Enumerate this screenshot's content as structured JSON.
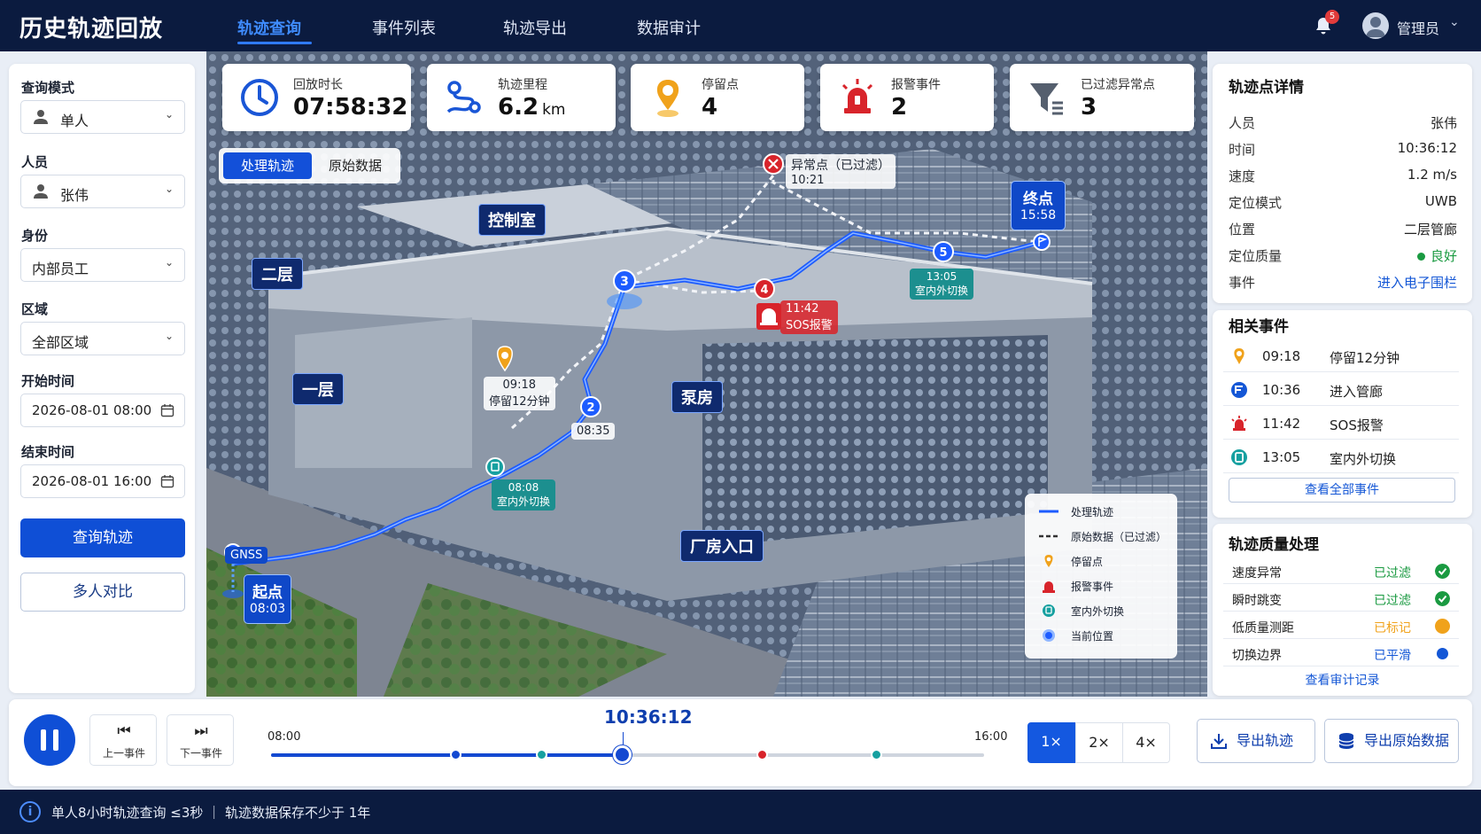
{
  "header": {
    "title": "历史轨迹回放",
    "tabs": [
      "轨迹查询",
      "事件列表",
      "轨迹导出",
      "数据审计"
    ],
    "notification_count": "5",
    "user": "管理员"
  },
  "query": {
    "mode_label": "查询模式",
    "mode_value": "单人",
    "person_label": "人员",
    "person_value": "张伟",
    "identity_label": "身份",
    "identity_value": "内部员工",
    "area_label": "区域",
    "area_value": "全部区域",
    "start_label": "开始时间",
    "start_value": "2026-08-01 08:00",
    "end_label": "结束时间",
    "end_value": "2026-08-01 16:00",
    "search_btn": "查询轨迹",
    "compare_btn": "多人对比"
  },
  "stats": [
    {
      "label": "回放时长",
      "value": "07:58:32",
      "unit": "",
      "icon": "clock-icon",
      "color": "#1a56d6"
    },
    {
      "label": "轨迹里程",
      "value": "6.2",
      "unit": "km",
      "icon": "route-icon",
      "color": "#1a56d6"
    },
    {
      "label": "停留点",
      "value": "4",
      "unit": "",
      "icon": "pin-icon",
      "color": "#f0a21b"
    },
    {
      "label": "报警事件",
      "value": "2",
      "unit": "",
      "icon": "alarm-icon",
      "color": "#d8242b"
    },
    {
      "label": "已过滤异常点",
      "value": "3",
      "unit": "",
      "icon": "filter-icon",
      "color": "#555f6e"
    }
  ],
  "view_toggle": {
    "processed": "处理轨迹",
    "raw": "原始数据"
  },
  "map": {
    "areas": {
      "floor2": "二层",
      "control": "控制室",
      "floor1": "一层",
      "pump": "泵房",
      "entrance": "厂房入口"
    },
    "start": {
      "title": "起点",
      "time": "08:03"
    },
    "end": {
      "title": "终点",
      "time": "15:58"
    },
    "gnss": "GNSS",
    "anomaly": {
      "title": "异常点（已过滤）",
      "time": "10:21"
    },
    "stay": {
      "time": "09:18",
      "text": "停留12分钟"
    },
    "node2_time": "08:35",
    "node1": {
      "time": "08:08",
      "text": "室内外切换"
    },
    "node4": {
      "time": "11:42",
      "text": "SOS报警"
    },
    "node5": {
      "time": "13:05",
      "text": "室内外切换"
    },
    "node_numbers": [
      "2",
      "3",
      "4",
      "5"
    ]
  },
  "legend": [
    {
      "label": "处理轨迹"
    },
    {
      "label": "原始数据（已过滤）"
    },
    {
      "label": "停留点"
    },
    {
      "label": "报警事件"
    },
    {
      "label": "室内外切换"
    },
    {
      "label": "当前位置"
    }
  ],
  "detail": {
    "title": "轨迹点详情",
    "rows": [
      {
        "k": "人员",
        "v": "张伟"
      },
      {
        "k": "时间",
        "v": "10:36:12"
      },
      {
        "k": "速度",
        "v": "1.2 m/s"
      },
      {
        "k": "定位模式",
        "v": "UWB"
      },
      {
        "k": "位置",
        "v": "二层管廊"
      },
      {
        "k": "定位质量",
        "v": "良好"
      },
      {
        "k": "事件",
        "v": "进入电子围栏"
      }
    ]
  },
  "events": {
    "title": "相关事件",
    "rows": [
      {
        "time": "09:18",
        "desc": "停留12分钟",
        "icon": "pin-icon"
      },
      {
        "time": "10:36",
        "desc": "进入管廊",
        "icon": "geofence-icon"
      },
      {
        "time": "11:42",
        "desc": "SOS报警",
        "icon": "alarm-icon"
      },
      {
        "time": "13:05",
        "desc": "室内外切换",
        "icon": "switch-icon"
      }
    ],
    "view_all": "查看全部事件"
  },
  "quality": {
    "title": "轨迹质量处理",
    "rows": [
      {
        "k": "速度异常",
        "s": "已过滤",
        "color": "#1a9a41"
      },
      {
        "k": "瞬时跳变",
        "s": "已过滤",
        "color": "#1a9a41"
      },
      {
        "k": "低质量测距",
        "s": "已标记",
        "color": "#f0a21b"
      },
      {
        "k": "切换边界",
        "s": "已平滑",
        "color": "#1457d6"
      }
    ],
    "audit_link": "查看审计记录"
  },
  "playback": {
    "prev": "上一事件",
    "next": "下一事件",
    "start": "08:00",
    "end": "16:00",
    "current": "10:36:12",
    "progress": 0.4935,
    "markers": [
      {
        "pos": 0.26,
        "color": "#1449d1"
      },
      {
        "pos": 0.38,
        "color": "#16a0a0"
      },
      {
        "pos": 0.69,
        "color": "#d8242b"
      },
      {
        "pos": 0.85,
        "color": "#16a0a0"
      }
    ],
    "speeds": [
      "1×",
      "2×",
      "4×"
    ],
    "export_track": "导出轨迹",
    "export_raw": "导出原始数据"
  },
  "footer": {
    "text": "单人8小时轨迹查询 ≤3秒 ｜ 轨迹数据保存不少于 1年"
  }
}
